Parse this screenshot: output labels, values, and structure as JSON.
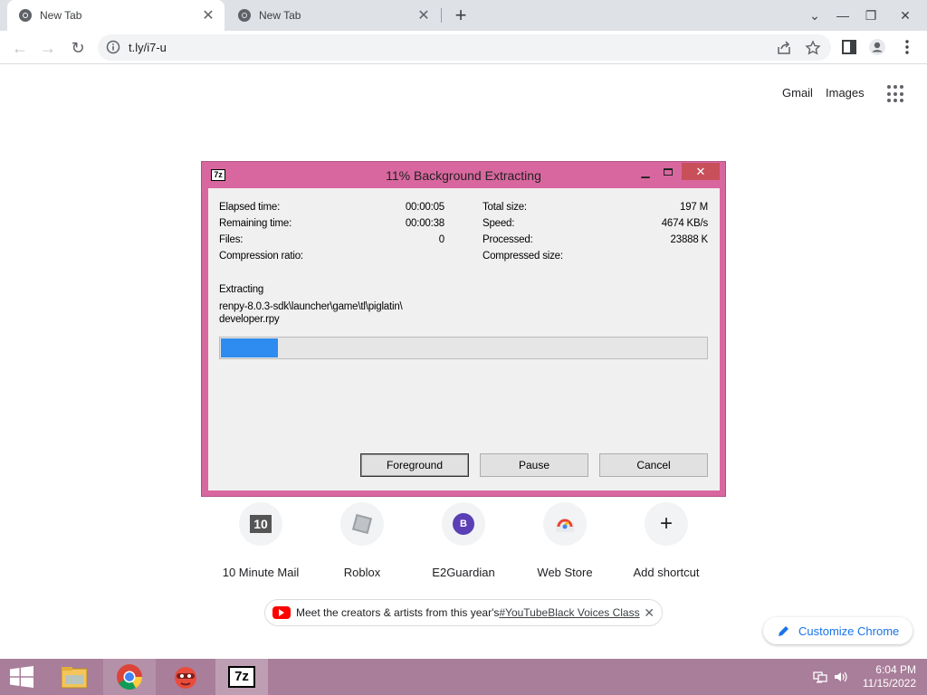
{
  "browser": {
    "tabs": [
      {
        "title": "New Tab",
        "active": true
      },
      {
        "title": "New Tab",
        "active": false
      }
    ],
    "url": "t.ly/i7-u"
  },
  "ntp": {
    "gmail": "Gmail",
    "images": "Images",
    "shortcuts": [
      {
        "label": "10 Minute Mail",
        "icon": "ten-minute-mail-icon"
      },
      {
        "label": "Roblox",
        "icon": "roblox-icon"
      },
      {
        "label": "E2Guardian",
        "icon": "e2guardian-icon",
        "letter": "B"
      },
      {
        "label": "Web Store",
        "icon": "web-store-icon"
      },
      {
        "label": "Add shortcut",
        "icon": "plus-icon"
      }
    ],
    "promo_text": "Meet the creators & artists from this year's ",
    "promo_link": "#YouTubeBlack Voices Class",
    "customize": "Customize Chrome"
  },
  "dialog": {
    "title": "11% Background Extracting",
    "app_badge": "7z",
    "elapsed_label": "Elapsed time:",
    "elapsed_value": "00:00:05",
    "remaining_label": "Remaining time:",
    "remaining_value": "00:00:38",
    "files_label": "Files:",
    "files_value": "0",
    "ratio_label": "Compression ratio:",
    "total_label": "Total size:",
    "total_value": "197 M",
    "speed_label": "Speed:",
    "speed_value": "4674 KB/s",
    "processed_label": "Processed:",
    "processed_value": "23888 K",
    "compressed_label": "Compressed size:",
    "status": "Extracting",
    "path_line1": "renpy-8.0.3-sdk\\launcher\\game\\tl\\piglatin\\",
    "path_line2": "developer.rpy",
    "progress_percent": 11,
    "buttons": {
      "foreground": "Foreground",
      "pause": "Pause",
      "cancel": "Cancel"
    }
  },
  "taskbar": {
    "time": "6:04 PM",
    "date": "11/15/2022",
    "app_badge": "7z"
  },
  "colors": {
    "dialog_frame": "#d9679f",
    "progress_fill": "#2e8cf0",
    "taskbar": "#a97e9a"
  }
}
